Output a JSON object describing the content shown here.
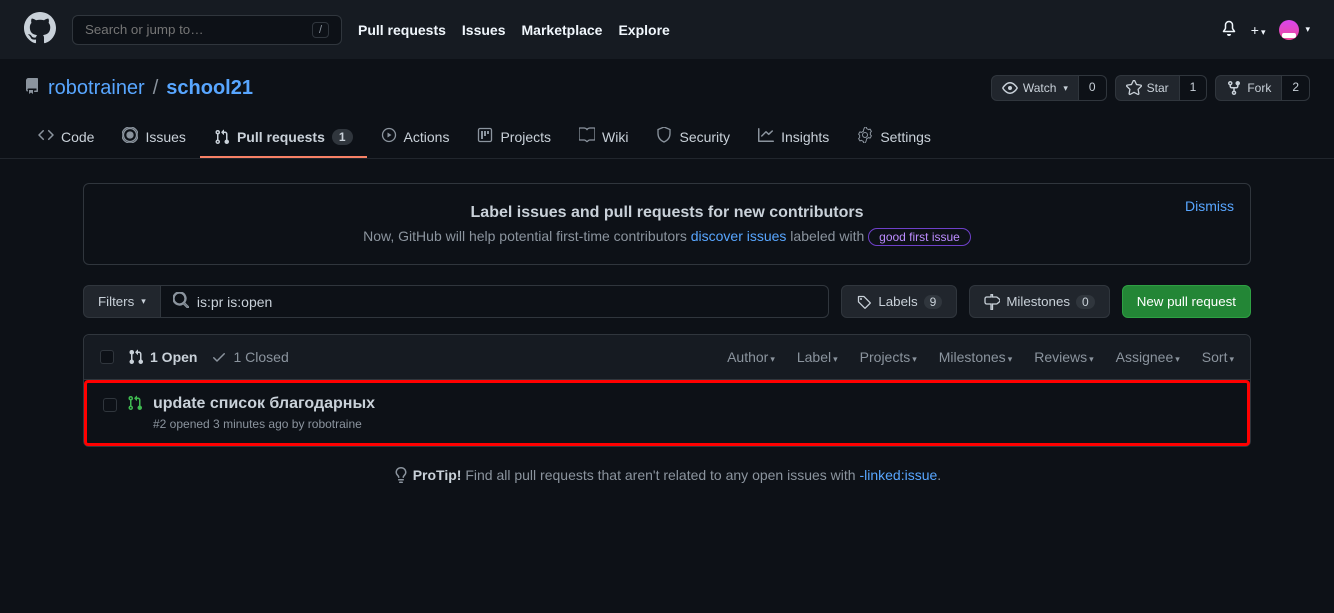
{
  "header": {
    "search_placeholder": "Search or jump to…",
    "nav": [
      "Pull requests",
      "Issues",
      "Marketplace",
      "Explore"
    ]
  },
  "repo": {
    "owner": "robotrainer",
    "name": "school21",
    "watch": "Watch",
    "watch_count": "0",
    "star": "Star",
    "star_count": "1",
    "fork": "Fork",
    "fork_count": "2"
  },
  "tabs": {
    "code": "Code",
    "issues": "Issues",
    "pulls": "Pull requests",
    "pulls_count": "1",
    "actions": "Actions",
    "projects": "Projects",
    "wiki": "Wiki",
    "security": "Security",
    "insights": "Insights",
    "settings": "Settings"
  },
  "banner": {
    "title": "Label issues and pull requests for new contributors",
    "text_before": "Now, GitHub will help potential first-time contributors ",
    "link": "discover issues",
    "text_after": " labeled with ",
    "label": "good first issue",
    "dismiss": "Dismiss"
  },
  "filters": {
    "button": "Filters",
    "query": "is:pr is:open",
    "labels": "Labels",
    "labels_count": "9",
    "milestones": "Milestones",
    "milestones_count": "0",
    "new_pr": "New pull request"
  },
  "list": {
    "open": "1 Open",
    "closed": "1 Closed",
    "dropdowns": [
      "Author",
      "Label",
      "Projects",
      "Milestones",
      "Reviews",
      "Assignee",
      "Sort"
    ]
  },
  "issue": {
    "title": "update список благодарных",
    "meta": "#2 opened 3 minutes ago by robotraine"
  },
  "protip": {
    "label": "ProTip!",
    "text": " Find all pull requests that aren't related to any open issues with ",
    "link": "-linked:issue",
    "dot": "."
  }
}
